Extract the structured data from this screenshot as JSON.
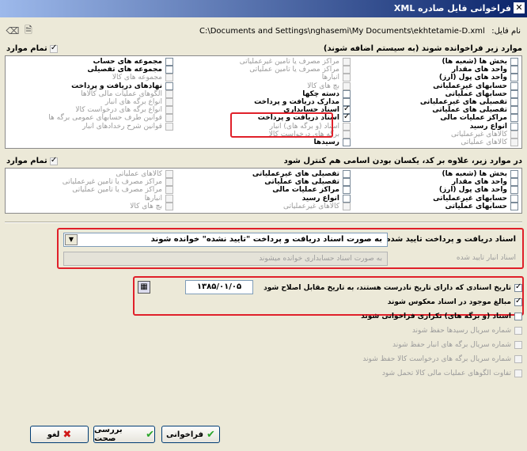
{
  "title": "فراخوانی فایل صادره XML",
  "file_label": "نام فایل:",
  "file_path": "C:\\Documents and Settings\\nghasemi\\My Documents\\ekhtetamie-D.xml",
  "section1": {
    "header": "موارد زیر فراخوانده شوند (به سیستم اضافه شوند)",
    "all_label": "تمام موارد",
    "col1": [
      {
        "t": "بخش ها (شعبه ها)",
        "c": false,
        "d": false
      },
      {
        "t": "واحد های مقدار",
        "c": false,
        "d": false
      },
      {
        "t": "واحد های پول (ارز)",
        "c": false,
        "d": false
      },
      {
        "t": "حسابهای غیرعملیاتی",
        "c": false,
        "d": false
      },
      {
        "t": "حسابهای عملیاتی",
        "c": false,
        "d": false
      },
      {
        "t": "تفصیلی های غیرعملیاتی",
        "c": false,
        "d": false
      },
      {
        "t": "تفصیلی های عملیاتی",
        "c": false,
        "d": false
      },
      {
        "t": "مراکز عملیات مالی",
        "c": false,
        "d": false
      },
      {
        "t": "انواع رسید",
        "c": false,
        "d": false
      },
      {
        "t": "کالاهای غیرعملیاتی",
        "c": false,
        "d": true
      },
      {
        "t": "کالاهای عملیاتی",
        "c": false,
        "d": true
      }
    ],
    "col2": [
      {
        "t": "مراکز مصرف یا تامین غیرعملیاتی",
        "c": false,
        "d": true
      },
      {
        "t": "مراکز مصرف یا تامین عملیاتی",
        "c": false,
        "d": true
      },
      {
        "t": "انبارها",
        "c": false,
        "d": true
      },
      {
        "t": "بچ های کالا",
        "c": false,
        "d": true
      },
      {
        "t": "دسته چکها",
        "c": false,
        "d": false
      },
      {
        "t": "مدارک دریافت و پرداخت",
        "c": false,
        "d": false
      },
      {
        "t": "اسناد حسابداری",
        "c": true,
        "d": false
      },
      {
        "t": "اسناد دریافت و پرداخت",
        "c": true,
        "d": false
      },
      {
        "t": "اسناد (و برگه های) انبار",
        "c": false,
        "d": true
      },
      {
        "t": "برگه های درخواست کالا",
        "c": false,
        "d": true
      },
      {
        "t": "رسیدها",
        "c": false,
        "d": false
      }
    ],
    "col3": [
      {
        "t": "مجموعه های حساب",
        "c": false,
        "d": false
      },
      {
        "t": "مجموعه های تفصیلی",
        "c": false,
        "d": false
      },
      {
        "t": "مجموعه های کالا",
        "c": false,
        "d": true
      },
      {
        "t": "نهادهای دریافت و پرداخت",
        "c": false,
        "d": false
      },
      {
        "t": "الگوهای عملیات مالی کالاها",
        "c": false,
        "d": true
      },
      {
        "t": "انواع برگه های انبار",
        "c": false,
        "d": true
      },
      {
        "t": "انواع برگه های درخواست کالا",
        "c": false,
        "d": true
      },
      {
        "t": "قوانین طرف حسابهای عمومی برگه ها",
        "c": false,
        "d": true
      },
      {
        "t": "قوانین شرح رخدادهای انبار",
        "c": false,
        "d": true
      }
    ]
  },
  "section2": {
    "header": "در موارد زیر، علاوه بر کد، یکسان بودن اسامی هم کنترل شود",
    "all_label": "تمام موارد",
    "col1": [
      {
        "t": "بخش ها (شعبه ها)",
        "c": false,
        "d": false
      },
      {
        "t": "واحد های مقدار",
        "c": false,
        "d": false
      },
      {
        "t": "واحد های پول (ارز)",
        "c": false,
        "d": false
      },
      {
        "t": "حسابهای غیرعملیاتی",
        "c": false,
        "d": false
      },
      {
        "t": "حسابهای عملیاتی",
        "c": false,
        "d": false
      }
    ],
    "col2": [
      {
        "t": "تفصیلی های غیرعملیاتی",
        "c": false,
        "d": false
      },
      {
        "t": "تفصیلی های عملیاتی",
        "c": false,
        "d": false
      },
      {
        "t": "مراکز عملیات مالی",
        "c": false,
        "d": false
      },
      {
        "t": "انواع رسید",
        "c": false,
        "d": false
      },
      {
        "t": "کالاهای غیرعملیاتی",
        "c": false,
        "d": true
      }
    ],
    "col3": [
      {
        "t": "کالاهای عملیاتی",
        "c": false,
        "d": true
      },
      {
        "t": "مراکز مصرف یا تامین غیرعملیاتی",
        "c": false,
        "d": true
      },
      {
        "t": "مراکز مصرف یا تامین عملیاتی",
        "c": false,
        "d": true
      },
      {
        "t": "انبارها",
        "c": false,
        "d": true
      },
      {
        "t": "بچ های کالا",
        "c": false,
        "d": true
      }
    ]
  },
  "confirm": {
    "label1": "اسناد دریافت و پرداخت تایید شده",
    "value1": "به صورت اسناد دریافت و پرداخت \"تایید نشده\" خوانده شوند",
    "label2": "اسناد انبار تایید شده",
    "value2": "به صورت اسناد حسابداری خوانده میشوند"
  },
  "options": [
    {
      "t": "تاریخ اسنادی که دارای تاریخ نادرست هستند، به تاریخ مقابل اصلاح شود",
      "c": true,
      "d": false
    },
    {
      "t": "مبالغ موجود در اسناد معکوس شوند",
      "c": true,
      "d": false
    },
    {
      "t": "اسناد (و برگه های) تکراری فراخوانی شوند",
      "c": false,
      "d": false
    },
    {
      "t": "شماره سریال رسیدها حفظ شوند",
      "c": false,
      "d": true
    },
    {
      "t": "شماره سریال برگه های انبار حفظ شوند",
      "c": false,
      "d": true
    },
    {
      "t": "شماره سریال برگه های درخواست کالا حفظ شوند",
      "c": false,
      "d": true
    },
    {
      "t": "تفاوت الگوهای عملیات مالی کالا تحمل شود",
      "c": false,
      "d": true
    }
  ],
  "date_value": "۱۳۸۵/۰۱/۰۵",
  "buttons": {
    "import": "فراخوانی",
    "check": "بررسی صحت",
    "cancel": "لغو"
  },
  "colors": {
    "red": "#e0202a",
    "green": "#2aa52a"
  }
}
